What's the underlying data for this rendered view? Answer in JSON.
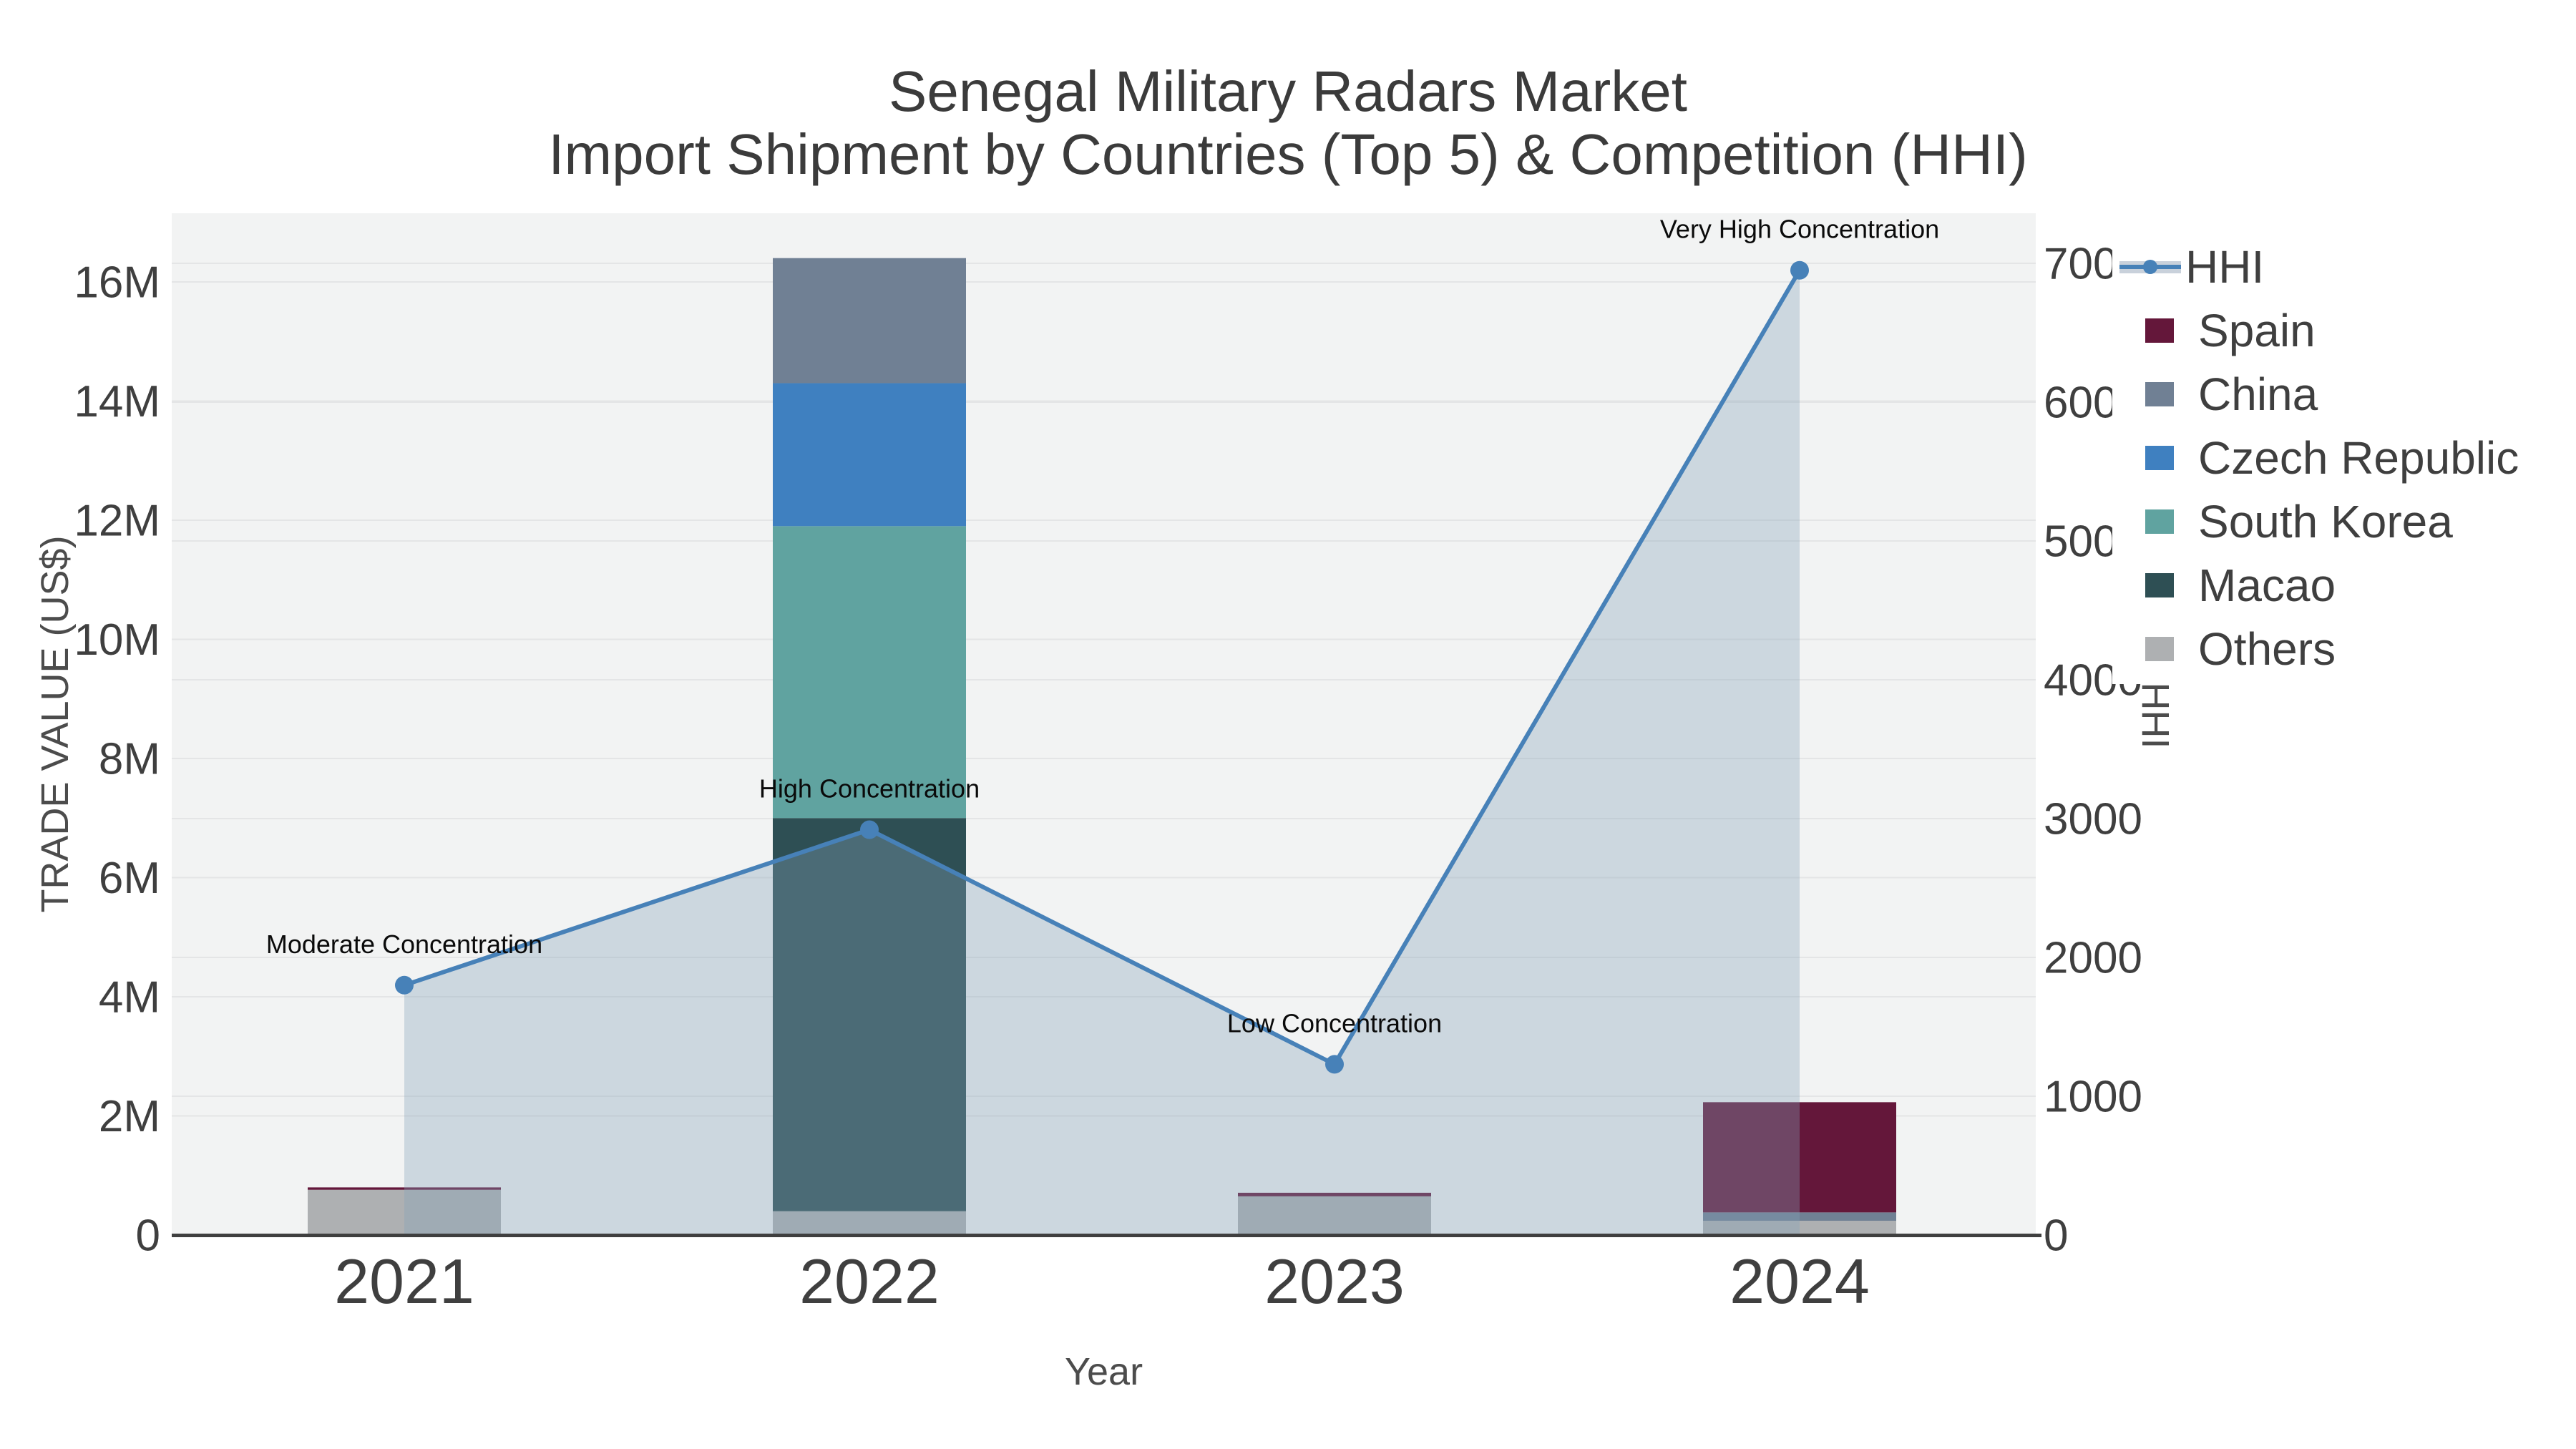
{
  "title": {
    "line1": "Senegal Military Radars Market",
    "line2": "Import Shipment by Countries (Top 5) & Competition (HHI)"
  },
  "axes": {
    "x": {
      "title": "Year",
      "categories": [
        "2021",
        "2022",
        "2023",
        "2024"
      ]
    },
    "y_left": {
      "title": "TRADE VALUE (US$)",
      "ticks": [
        "0",
        "2M",
        "4M",
        "6M",
        "8M",
        "10M",
        "12M",
        "14M",
        "16M"
      ],
      "range": [
        0,
        16000000
      ]
    },
    "y_right": {
      "title": "HHI",
      "ticks": [
        "0",
        "1000",
        "2000",
        "3000",
        "4000",
        "5000",
        "6000",
        "7000"
      ],
      "range": [
        0,
        7000
      ]
    }
  },
  "legend": {
    "items": [
      {
        "label": "HHI",
        "type": "line",
        "color": "#4781B8"
      },
      {
        "label": "Spain",
        "type": "box",
        "color": "#64173A"
      },
      {
        "label": "China",
        "type": "box",
        "color": "#708094"
      },
      {
        "label": "Czech Republic",
        "type": "box",
        "color": "#3F80C0"
      },
      {
        "label": "South Korea",
        "type": "box",
        "color": "#60A3A0"
      },
      {
        "label": "Macao",
        "type": "box",
        "color": "#2E4F54"
      },
      {
        "label": "Others",
        "type": "box",
        "color": "#AEB0B2"
      }
    ]
  },
  "chart_data": {
    "type": "bar+line",
    "title": "Senegal Military Radars Market — Import Shipment by Countries (Top 5) & Competition (HHI)",
    "xlabel": "Year",
    "ylabel": "TRADE VALUE (US$)",
    "ylabel2": "HHI",
    "categories": [
      "2021",
      "2022",
      "2023",
      "2024"
    ],
    "bar_stack_bottom_to_top": [
      "Others",
      "Macao",
      "South Korea",
      "Czech Republic",
      "China",
      "Spain"
    ],
    "series": [
      {
        "name": "Others",
        "color": "#AEB0B2",
        "values": [
          760000,
          400000,
          650000,
          240000
        ]
      },
      {
        "name": "Macao",
        "color": "#2E4F54",
        "values": [
          0,
          6600000,
          0,
          0
        ]
      },
      {
        "name": "South Korea",
        "color": "#60A3A0",
        "values": [
          0,
          4900000,
          0,
          0
        ]
      },
      {
        "name": "Czech Republic",
        "color": "#3F80C0",
        "values": [
          0,
          2400000,
          0,
          0
        ]
      },
      {
        "name": "China",
        "color": "#708094",
        "values": [
          0,
          2100000,
          0,
          140000
        ]
      },
      {
        "name": "Spain",
        "color": "#64173A",
        "values": [
          40000,
          0,
          60000,
          1850000
        ]
      }
    ],
    "line_series": {
      "name": "HHI",
      "color": "#4781B8",
      "area_fill": "rgba(132,160,185,0.34)",
      "values": [
        1800,
        2920,
        1230,
        6950
      ]
    },
    "annotations": [
      {
        "text": "Moderate Concentration",
        "x": "2021",
        "y": 1800
      },
      {
        "text": "High Concentration",
        "x": "2022",
        "y": 2920
      },
      {
        "text": "Low Concentration",
        "x": "2023",
        "y": 1230
      },
      {
        "text": "Very High Concentration",
        "x": "2024",
        "y": 6950
      }
    ],
    "ylim": [
      0,
      16000000
    ],
    "y2lim": [
      0,
      7000
    ],
    "grid": true,
    "legend_position": "right"
  },
  "colors": {
    "plot_bg": "#F2F3F3",
    "grid": "#E4E5E6",
    "axis_line": "#3F3F3F",
    "tick_text": "#3F3F3F",
    "annotation_text": "#0a0a0a"
  }
}
